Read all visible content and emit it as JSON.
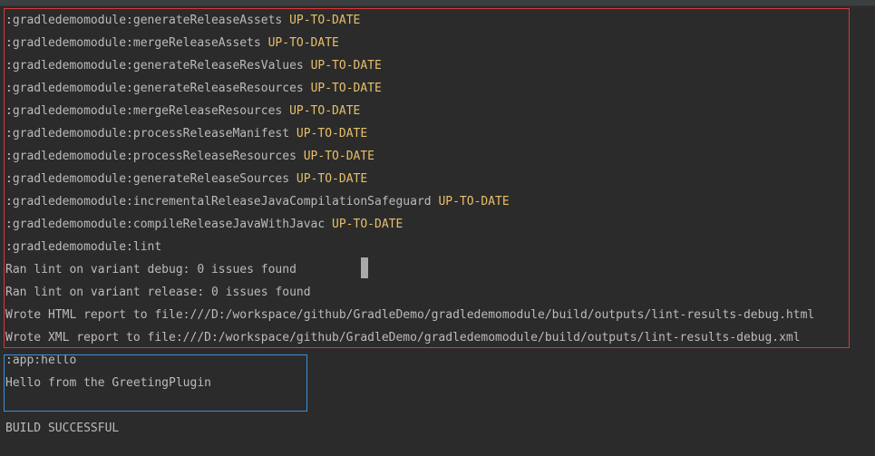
{
  "lines": [
    {
      "text": ":gradledemomodule:generateReleaseAssets",
      "status": "UP-TO-DATE"
    },
    {
      "text": ":gradledemomodule:mergeReleaseAssets",
      "status": "UP-TO-DATE"
    },
    {
      "text": ":gradledemomodule:generateReleaseResValues",
      "status": "UP-TO-DATE"
    },
    {
      "text": ":gradledemomodule:generateReleaseResources",
      "status": "UP-TO-DATE"
    },
    {
      "text": ":gradledemomodule:mergeReleaseResources",
      "status": "UP-TO-DATE"
    },
    {
      "text": ":gradledemomodule:processReleaseManifest",
      "status": "UP-TO-DATE"
    },
    {
      "text": ":gradledemomodule:processReleaseResources",
      "status": "UP-TO-DATE"
    },
    {
      "text": ":gradledemomodule:generateReleaseSources",
      "status": "UP-TO-DATE"
    },
    {
      "text": ":gradledemomodule:incrementalReleaseJavaCompilationSafeguard",
      "status": "UP-TO-DATE"
    },
    {
      "text": ":gradledemomodule:compileReleaseJavaWithJavac",
      "status": "UP-TO-DATE"
    },
    {
      "text": ":gradledemomodule:lint"
    },
    {
      "text": "Ran lint on variant debug: 0 issues found"
    },
    {
      "text": "Ran lint on variant release: 0 issues found"
    },
    {
      "text": "Wrote HTML report to file:///D:/workspace/github/GradleDemo/gradledemomodule/build/outputs/lint-results-debug.html"
    },
    {
      "text": "Wrote XML report to file:///D:/workspace/github/GradleDemo/gradledemomodule/build/outputs/lint-results-debug.xml"
    },
    {
      "text": ":app:hello"
    },
    {
      "text": "Hello from the GreetingPlugin"
    },
    {
      "text": ""
    },
    {
      "text": "BUILD SUCCESSFUL"
    }
  ],
  "colors": {
    "background": "#2b2b2b",
    "text": "#bbbbbb",
    "status": "#e8bf6a",
    "highlight_red": "#d9363e",
    "highlight_blue": "#3c8fd8"
  }
}
